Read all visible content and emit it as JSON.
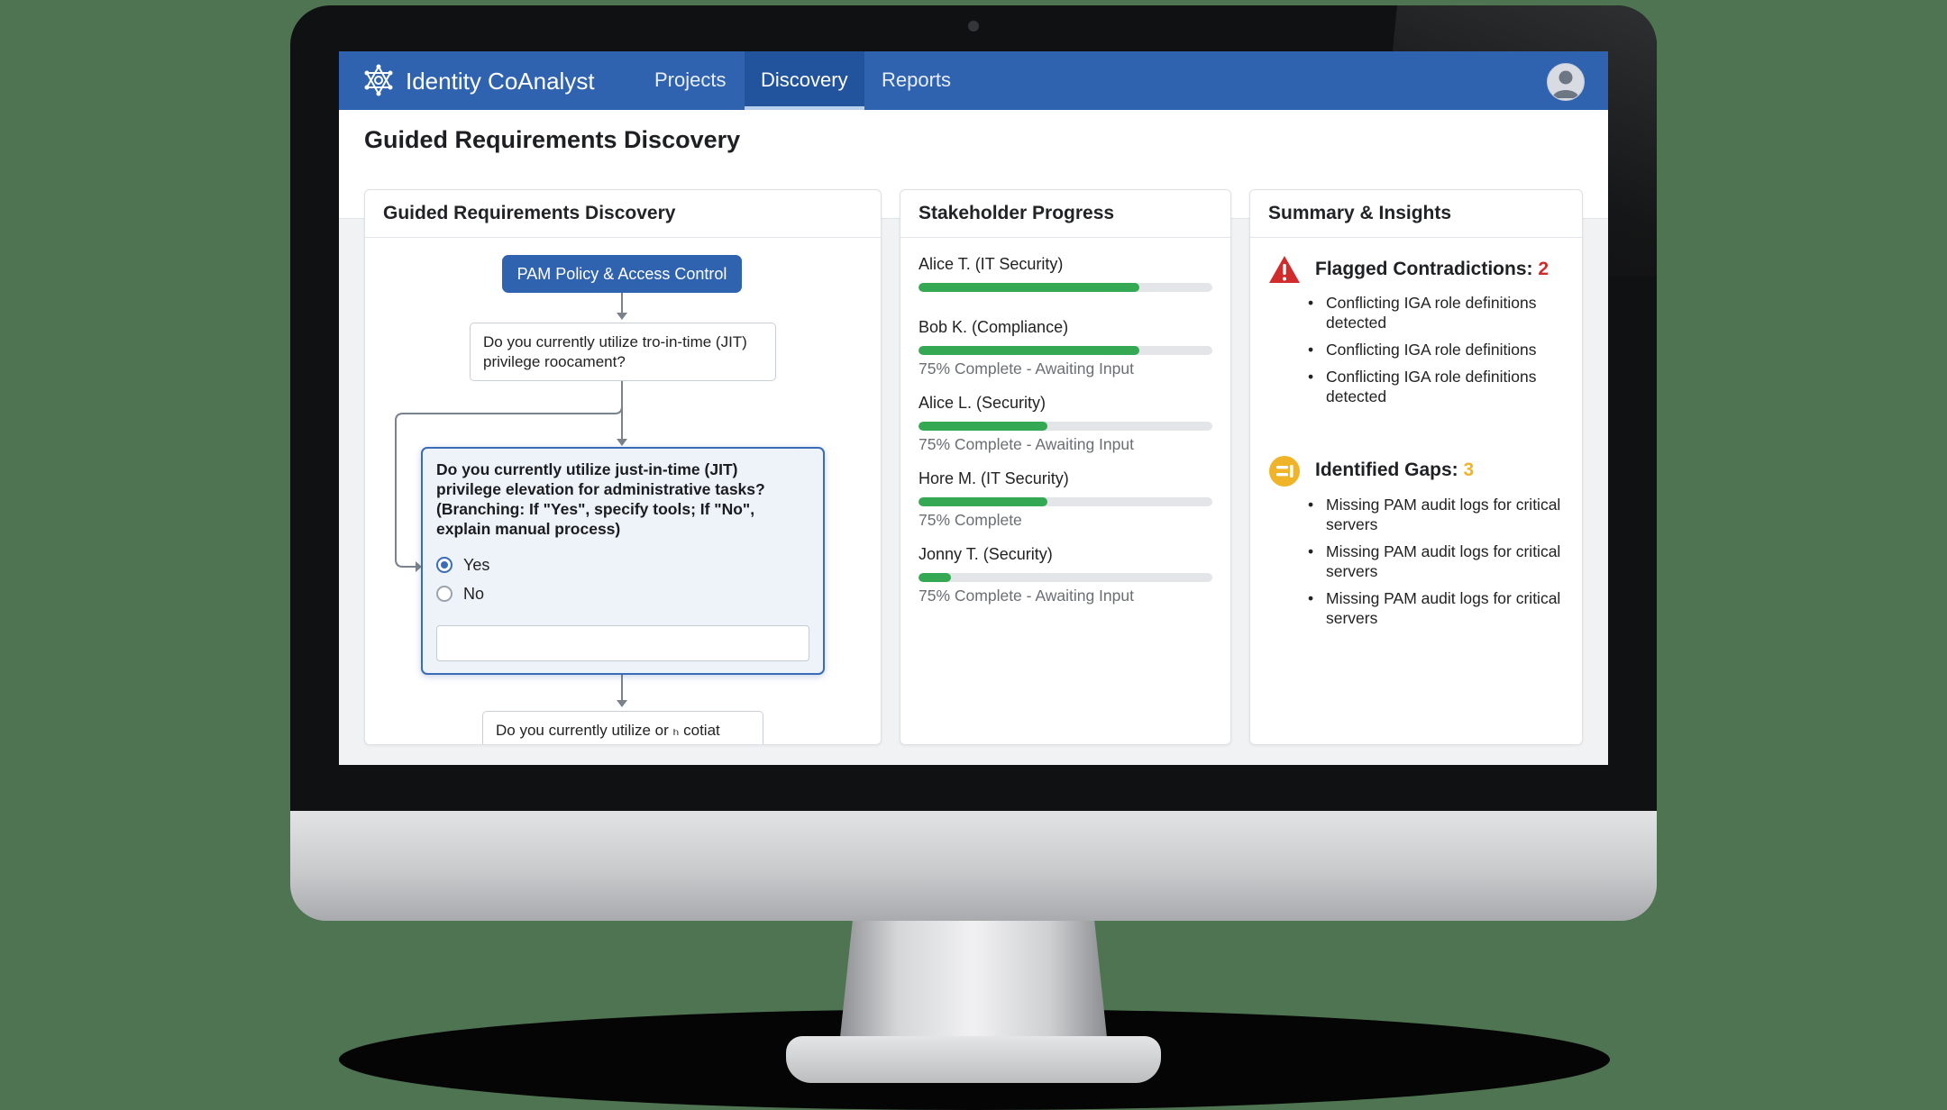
{
  "app": {
    "title": "Identity CoAnalyst",
    "logo_icon": "atom-network-icon",
    "nav_tabs": [
      {
        "label": "Projects",
        "active": false
      },
      {
        "label": "Discovery",
        "active": true
      },
      {
        "label": "Reports",
        "active": false
      }
    ],
    "avatar_icon": "user-avatar-icon",
    "colors": {
      "brand": "#2f63b0",
      "accent": "#3a6cb8",
      "progress": "#34a853",
      "alert": "#d12c2c",
      "warning": "#f0b429"
    }
  },
  "page": {
    "title": "Guided Requirements Discovery"
  },
  "discovery_panel": {
    "title": "Guided Requirements Discovery",
    "topic": "PAM Policy & Access Control",
    "question_top": "Do you currently utilize tro-in-time (JIT) privilege roocament?",
    "question_main": "Do you currently utilize just-in-time (JIT) privilege elevation for administrative tasks? (Branching: If \"Yes\", specify tools; If \"No\", explain manual process)",
    "options": [
      {
        "label": "Yes",
        "selected": true
      },
      {
        "label": "No",
        "selected": false
      }
    ],
    "answer_value": "",
    "question_next": "Do you currently utilize or ₕ cotiat administrative content?"
  },
  "stakeholder_panel": {
    "title": "Stakeholder Progress",
    "stakeholders": [
      {
        "name": "Alice T. (IT Security)",
        "progress": 0.75,
        "status": ""
      },
      {
        "name": "Bob K. (Compliance)",
        "progress": 0.75,
        "status": "75% Complete - Awaiting Input"
      },
      {
        "name": "Alice L. (Security)",
        "progress": 0.44,
        "status": "75% Complete - Awaiting Input"
      },
      {
        "name": "Hore M. (IT Security)",
        "progress": 0.44,
        "status": "75% Complete"
      },
      {
        "name": "Jonny T. (Security)",
        "progress": 0.11,
        "status": "75% Complete - Awaiting Input"
      }
    ]
  },
  "summary_panel": {
    "title": "Summary & Insights",
    "contradictions": {
      "label": "Flagged Contradictions:",
      "count": "2",
      "icon": "warning-triangle-icon",
      "items": [
        "Conflicting IGA role definitions detected",
        "Conflicting IGA role definitions",
        "Conflicting IGA role definitions detected"
      ]
    },
    "gaps": {
      "label": "Identified Gaps:",
      "count": "3",
      "icon": "gap-indicator-icon",
      "items": [
        "Missing PAM audit logs for critical servers",
        "Missing PAM audit logs for critical servers",
        "Missing PAM audit logs for critical servers"
      ]
    }
  }
}
